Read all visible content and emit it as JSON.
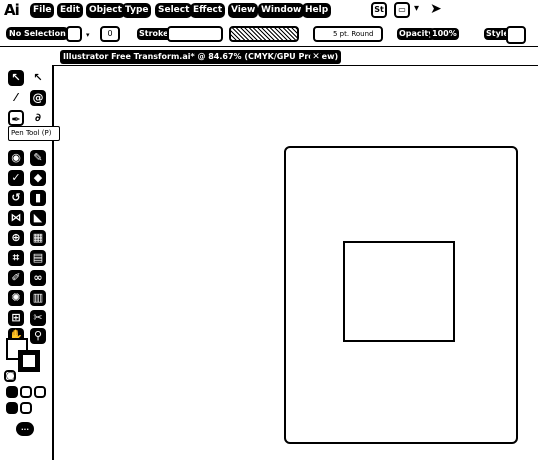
{
  "app": {
    "logo": "Ai"
  },
  "menu": [
    "File",
    "Edit",
    "Object",
    "Type",
    "Select",
    "Effect",
    "View",
    "Window",
    "Help"
  ],
  "menu_icons": {
    "bridge": "St",
    "workspace": "▭",
    "arrange": "▾",
    "share": "➤"
  },
  "control": {
    "selection": "No Selection",
    "fill_value": "0",
    "stroke_label": "Stroke",
    "brush": "5 pt. Round",
    "opacity_label": "Opacity",
    "opacity_value": "100%",
    "style_label": "Style"
  },
  "document": {
    "tab_title": "Illustrator Free Transform.ai* @ 84.67% (CMYK/GPU Preview)",
    "close": "✕"
  },
  "tooltip": "Pen Tool (P)",
  "tools": [
    "selection-icon",
    "direct-selection-icon",
    "magic-wand-icon",
    "lasso-icon",
    "pen-icon",
    "curvature-icon",
    "type-icon",
    "line-icon",
    "rectangle-icon",
    "paintbrush-icon",
    "shaper-icon",
    "pencil-icon",
    "eraser-icon",
    "rotate-icon",
    "scale-icon",
    "width-icon",
    "free-transform-icon",
    "shape-builder-icon",
    "perspective-icon",
    "mesh-icon",
    "gradient-icon",
    "eyedropper-icon",
    "blend-icon",
    "symbol-sprayer-icon",
    "graph-icon",
    "artboard-icon",
    "slice-icon",
    "hand-icon",
    "zoom-icon"
  ]
}
